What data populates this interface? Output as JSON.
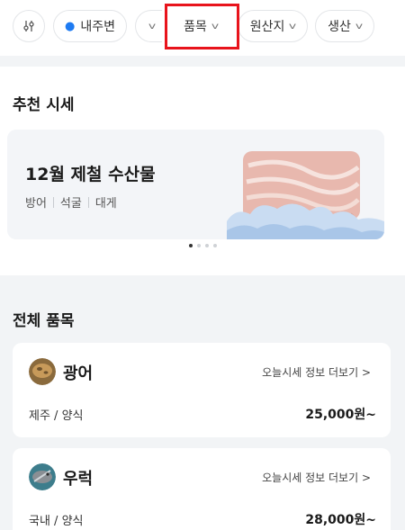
{
  "filters": {
    "location": "내주변",
    "chips": [
      {
        "label": "품목"
      },
      {
        "label": "원산지"
      },
      {
        "label": "생산"
      }
    ]
  },
  "recommended": {
    "title": "추천 시세",
    "banner": {
      "title": "12월 제철 수산물",
      "tags": [
        "방어",
        "석굴",
        "대게"
      ]
    },
    "page_count": 4,
    "active_page": 1
  },
  "all_items": {
    "title": "전체 품목",
    "items": [
      {
        "name": "광어",
        "link": "오늘시세 정보 더보기 >",
        "origin": "제주 / 양식",
        "price": "25,000원~"
      },
      {
        "name": "우럭",
        "link": "오늘시세 정보 더보기 >",
        "origin": "국내 / 양식",
        "price": "28,000원~"
      }
    ]
  },
  "colors": {
    "accent_blue": "#1e7bf2",
    "highlight_red": "#e8141c",
    "background": "#f2f4f6"
  }
}
